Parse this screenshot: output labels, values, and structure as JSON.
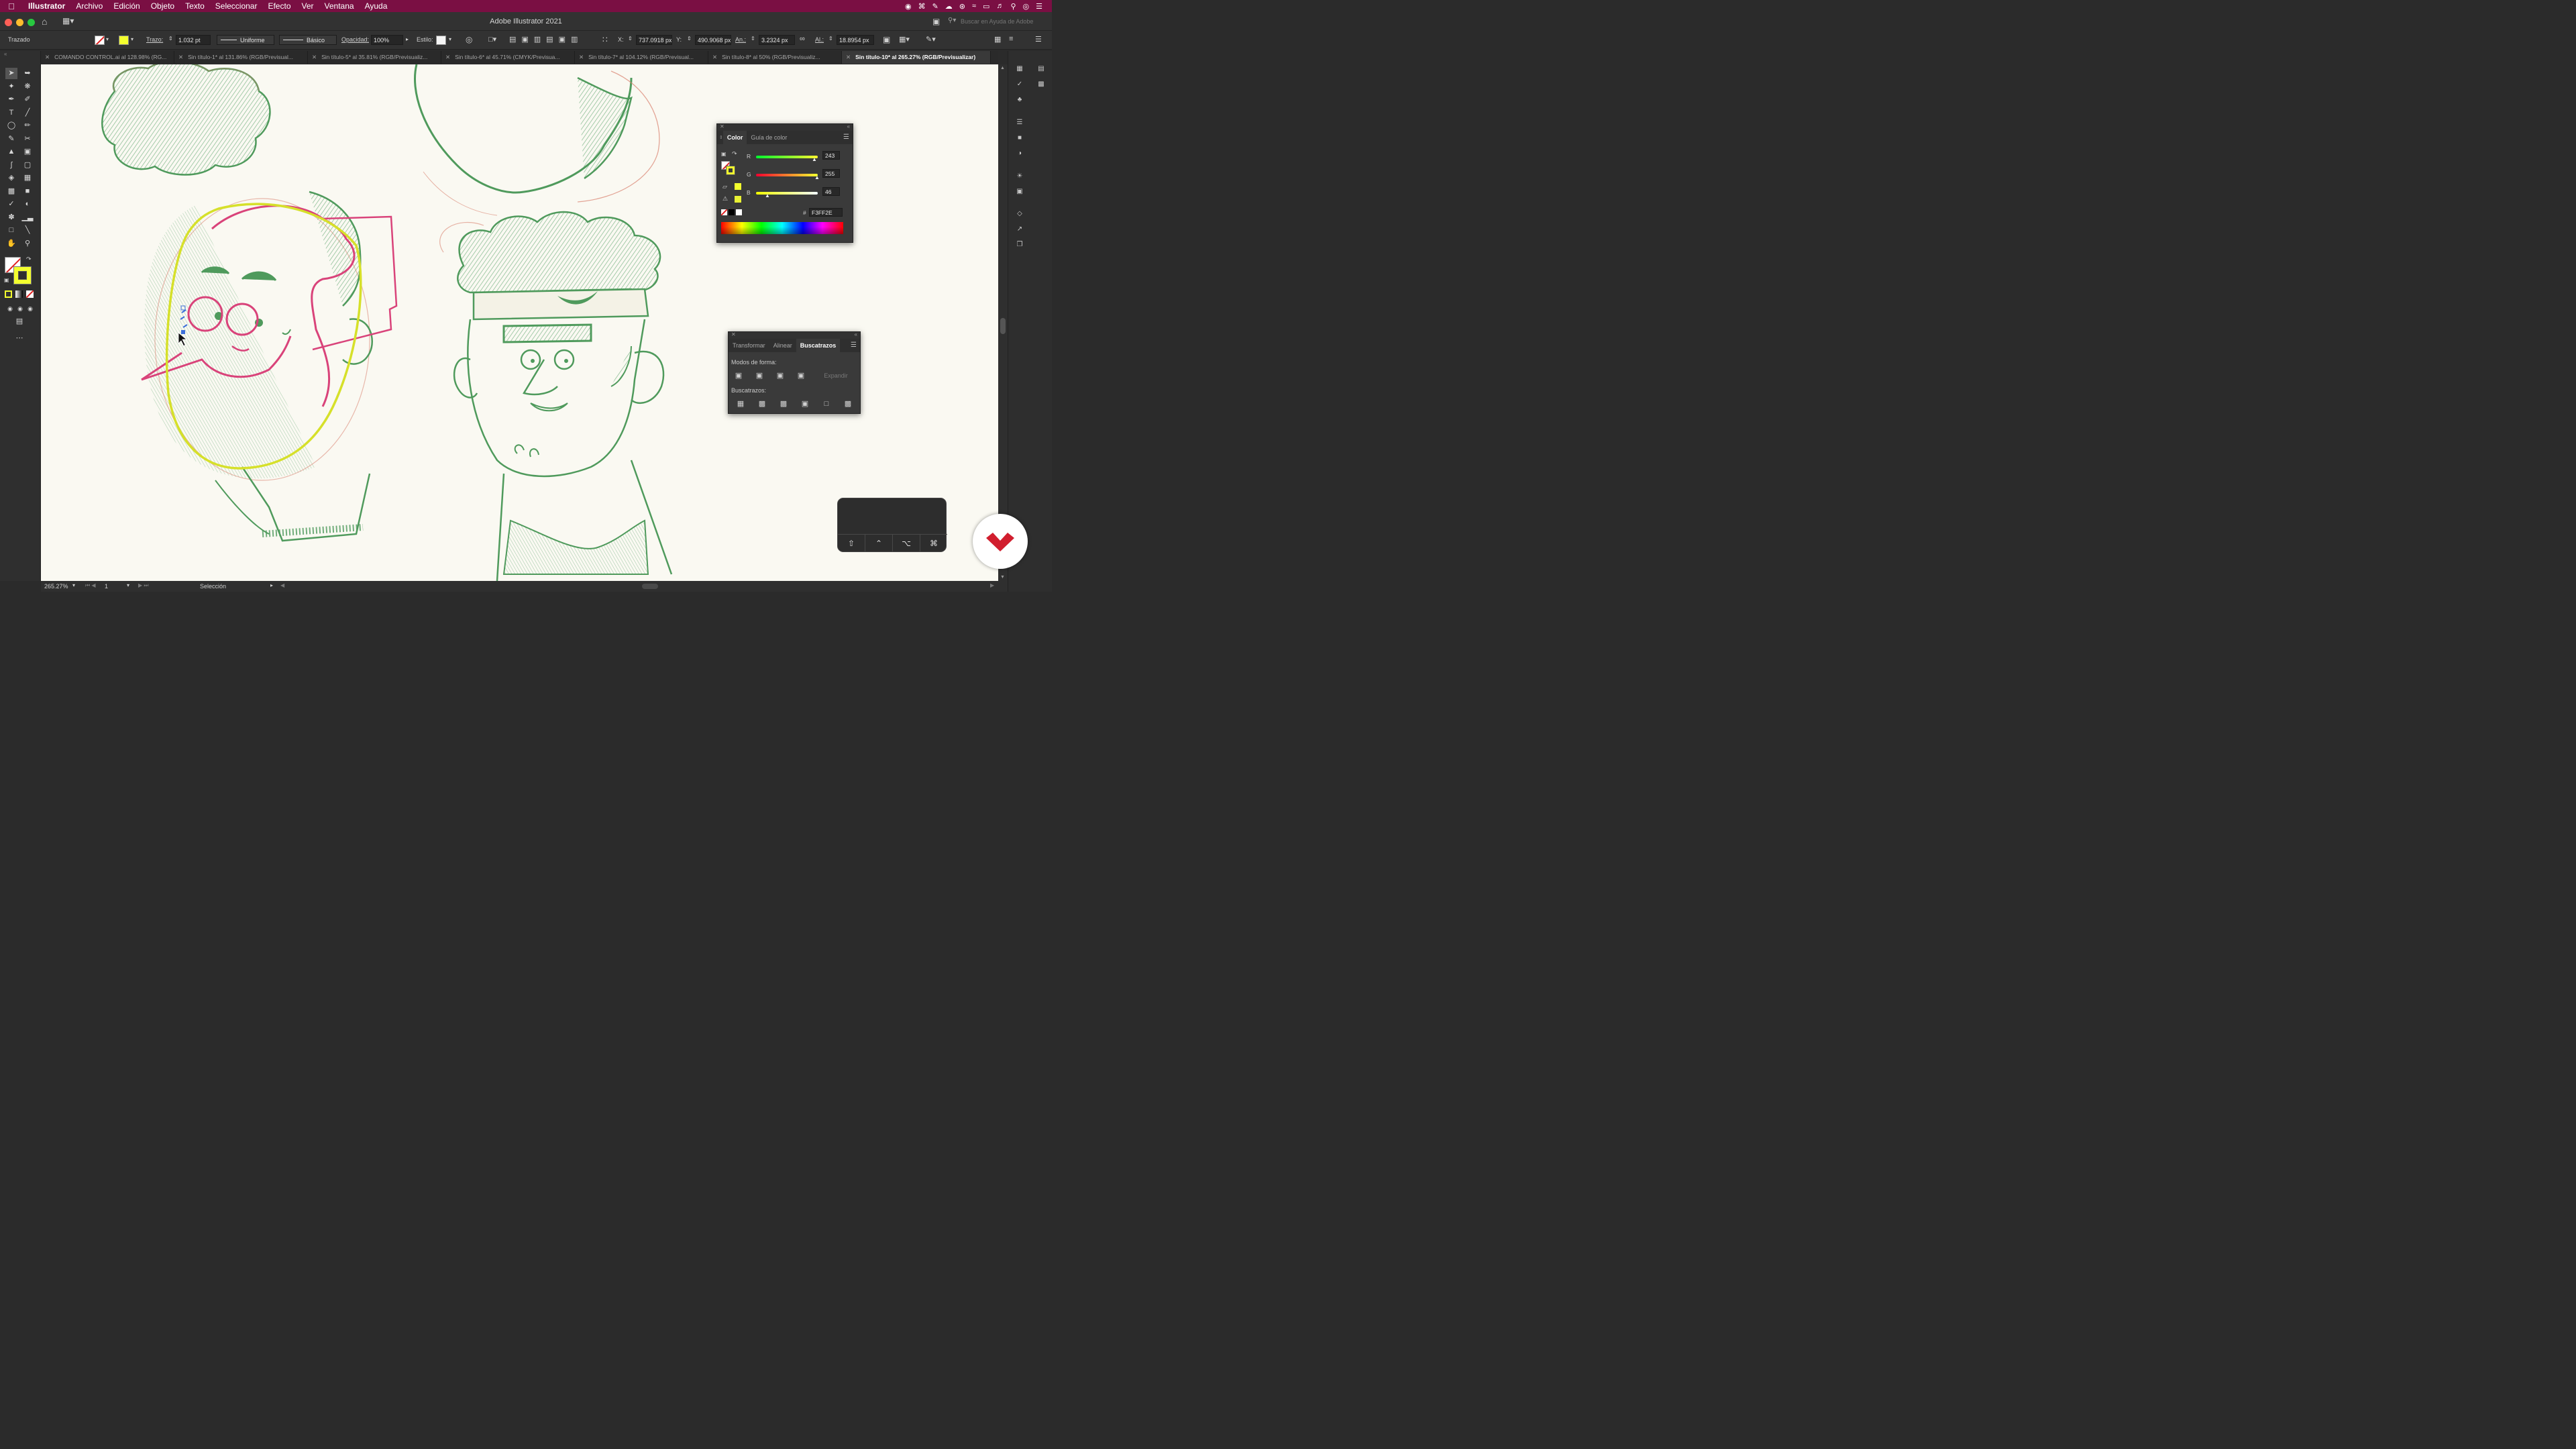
{
  "menubar": {
    "app_name": "Illustrator",
    "items": [
      "Archivo",
      "Edición",
      "Objeto",
      "Texto",
      "Seleccionar",
      "Efecto",
      "Ver",
      "Ventana",
      "Ayuda"
    ]
  },
  "window": {
    "title": "Adobe Illustrator 2021",
    "search_placeholder": "Buscar en Ayuda de Adobe"
  },
  "control": {
    "selection_label": "Trazado",
    "stroke_label": "Trazo:",
    "stroke_weight": "1.032 pt",
    "profile": "Uniforme",
    "brush": "Básico",
    "opacity_label": "Opacidad:",
    "opacity": "100%",
    "style_label": "Estilo:",
    "x_label": "X:",
    "x": "737.0918 px",
    "y_label": "Y:",
    "y": "490.9068 px",
    "w_label": "An.:",
    "w": "3.2324 px",
    "h_label": "Al.:",
    "h": "18.8954 px"
  },
  "tabs": [
    {
      "label": "COMANDO CONTROL.ai al 128.98% (RG...",
      "active": false
    },
    {
      "label": "Sin título-1* al 131.86% (RGB/Previsual...",
      "active": false
    },
    {
      "label": "Sin título-5* al 35.81% (RGB/Previsualiz...",
      "active": false
    },
    {
      "label": "Sin título-6* al 45.71% (CMYK/Previsua...",
      "active": false
    },
    {
      "label": "Sin título-7* al 104.12% (RGB/Previsual...",
      "active": false
    },
    {
      "label": "Sin título-8* al 50% (RGB/Previsualiz...",
      "active": false
    },
    {
      "label": "Sin título-10* al 265.27% (RGB/Previsualizar)",
      "active": true
    }
  ],
  "color_panel": {
    "tabs": [
      "Color",
      "Guía de color"
    ],
    "r_label": "R",
    "r": "243",
    "g_label": "G",
    "g": "255",
    "b_label": "B",
    "b": "46",
    "hash_label": "#",
    "hex": "F3FF2E",
    "fill_color": "#F3FF2E"
  },
  "pathfinder_panel": {
    "tabs": [
      "Transformar",
      "Alinear",
      "Buscatrazos"
    ],
    "shape_modes_label": "Modos de forma:",
    "expand_label": "Expandir",
    "pathfinders_label": "Buscatrazos:"
  },
  "status": {
    "zoom": "265.27%",
    "artboard": "1",
    "tool": "Selección"
  },
  "keys": [
    "⇧",
    "⌃",
    "⌥",
    "⌘"
  ],
  "colors": {
    "menubar_bg": "#7a0f43",
    "selection_yellow": "#d6e02a",
    "path_pink": "#d9437a",
    "pencil_green": "#4f9a5c",
    "pencil_red": "#d9826f",
    "logo_red": "#d11e2e"
  }
}
